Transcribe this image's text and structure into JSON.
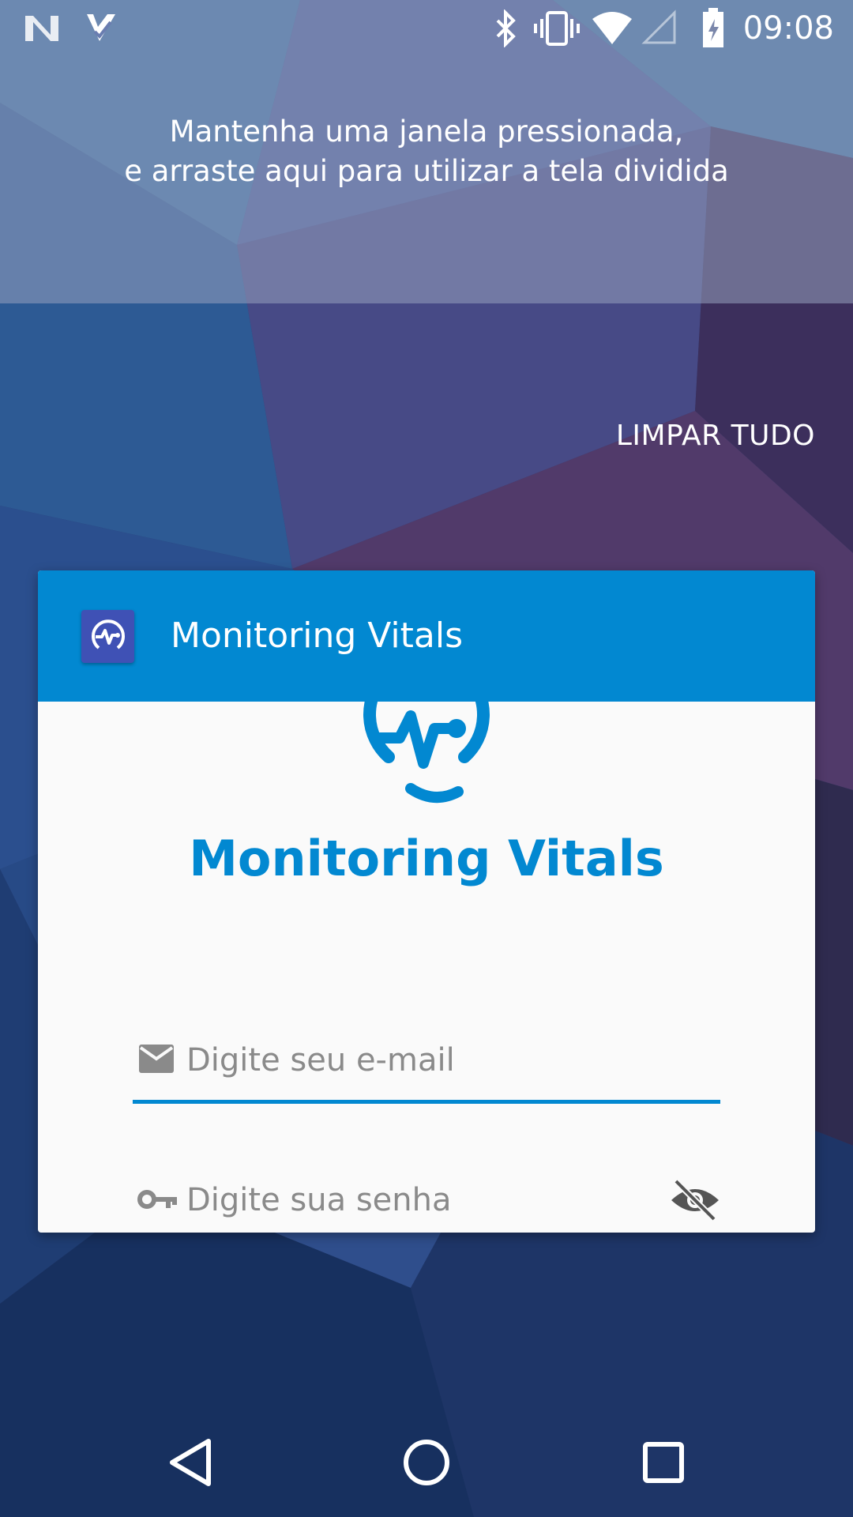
{
  "status_bar": {
    "time": "09:08",
    "left_icons": [
      "n-logo-icon",
      "task-check-icon"
    ],
    "right_icons": [
      "bluetooth-icon",
      "vibrate-icon",
      "wifi-icon",
      "cell-signal-icon",
      "battery-icon"
    ]
  },
  "split_screen_hint": {
    "line1": "Mantenha uma janela pressionada,",
    "line2": "e arraste aqui para utilizar a tela dividida"
  },
  "recents": {
    "clear_all_label": "LIMPAR TUDO"
  },
  "app_card": {
    "title": "Monitoring Vitals",
    "header_color": "#0288d1",
    "icon": "heartbeat-logo-icon"
  },
  "login": {
    "brand_name": "Monitoring Vitals",
    "brand_color": "#0288d1",
    "email": {
      "icon": "mail-icon",
      "placeholder": "Digite seu e-mail",
      "value": ""
    },
    "password": {
      "icon": "key-icon",
      "placeholder": "Digite sua senha",
      "value": "",
      "toggle_icon": "eye-off-icon"
    }
  },
  "nav_bar": {
    "buttons": [
      "back-icon",
      "home-icon",
      "recents-icon"
    ]
  }
}
